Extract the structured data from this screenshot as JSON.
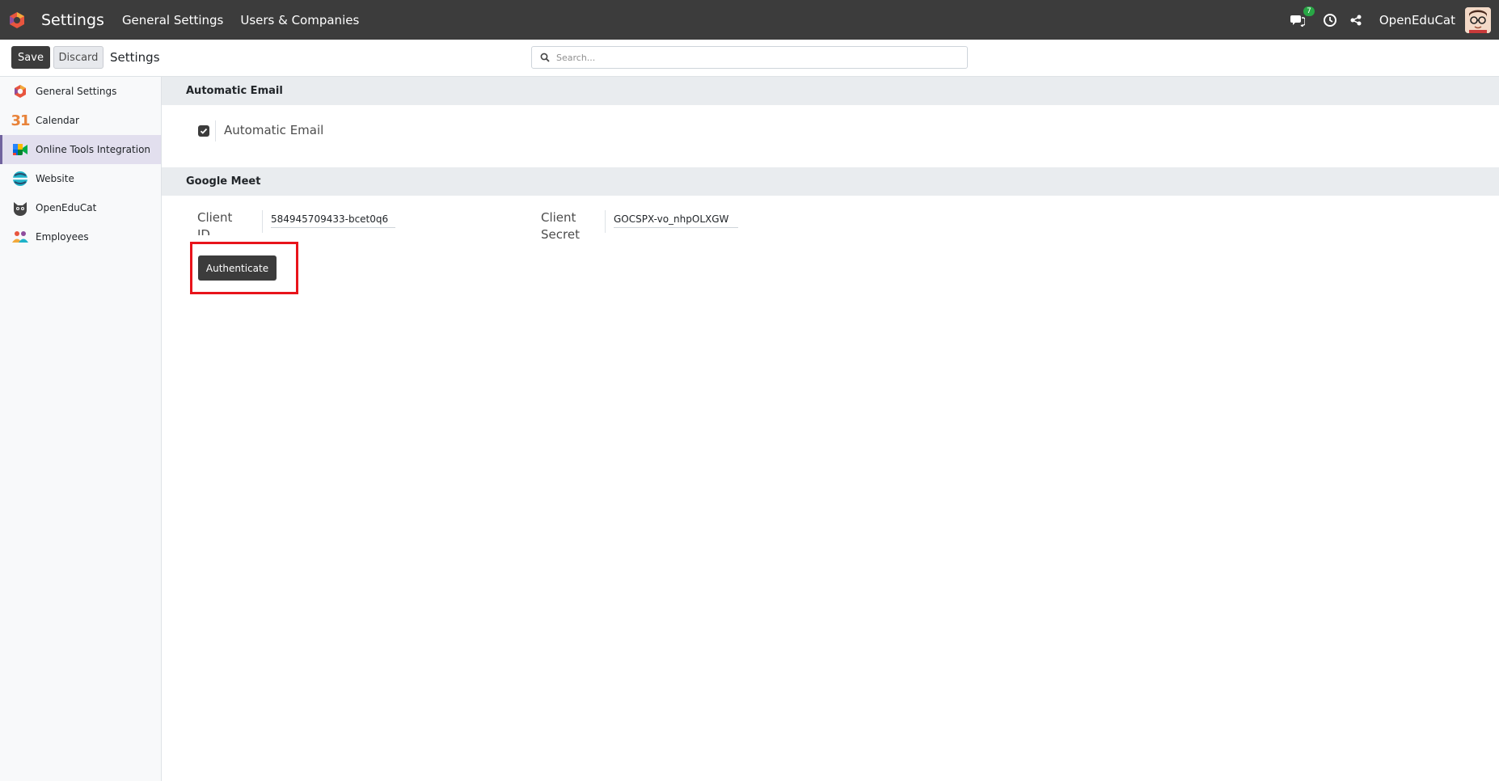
{
  "navbar": {
    "app_title": "Settings",
    "menu": [
      "General Settings",
      "Users & Companies"
    ],
    "chat_badge": "7",
    "user_name": "OpenEduCat"
  },
  "control_panel": {
    "save_label": "Save",
    "discard_label": "Discard",
    "title": "Settings",
    "search_placeholder": "Search..."
  },
  "sidebar": {
    "items": [
      {
        "label": "General Settings",
        "icon": "settings-icon",
        "active": false
      },
      {
        "label": "Calendar",
        "icon": "calendar-icon",
        "active": false
      },
      {
        "label": "Online Tools Integration",
        "icon": "meet-icon",
        "active": true
      },
      {
        "label": "Website",
        "icon": "website-icon",
        "active": false
      },
      {
        "label": "OpenEduCat",
        "icon": "openeducat-icon",
        "active": false
      },
      {
        "label": "Employees",
        "icon": "employees-icon",
        "active": false
      }
    ]
  },
  "sections": {
    "automatic_email": {
      "header": "Automatic Email",
      "checkbox_label": "Automatic Email",
      "checked": true
    },
    "google_meet": {
      "header": "Google Meet",
      "client_id_label_1": "Client",
      "client_id_label_2": "ID",
      "client_id_value": "584945709433-bcet0q6",
      "client_secret_label_1": "Client",
      "client_secret_label_2": "Secret",
      "client_secret_value": "GOCSPX-vo_nhpOLXGW",
      "authenticate_label": "Authenticate"
    }
  },
  "colors": {
    "navbar_bg": "#3c3c3c",
    "highlight_border": "#e8141b",
    "active_sidebar_bg": "#e2dfee"
  }
}
